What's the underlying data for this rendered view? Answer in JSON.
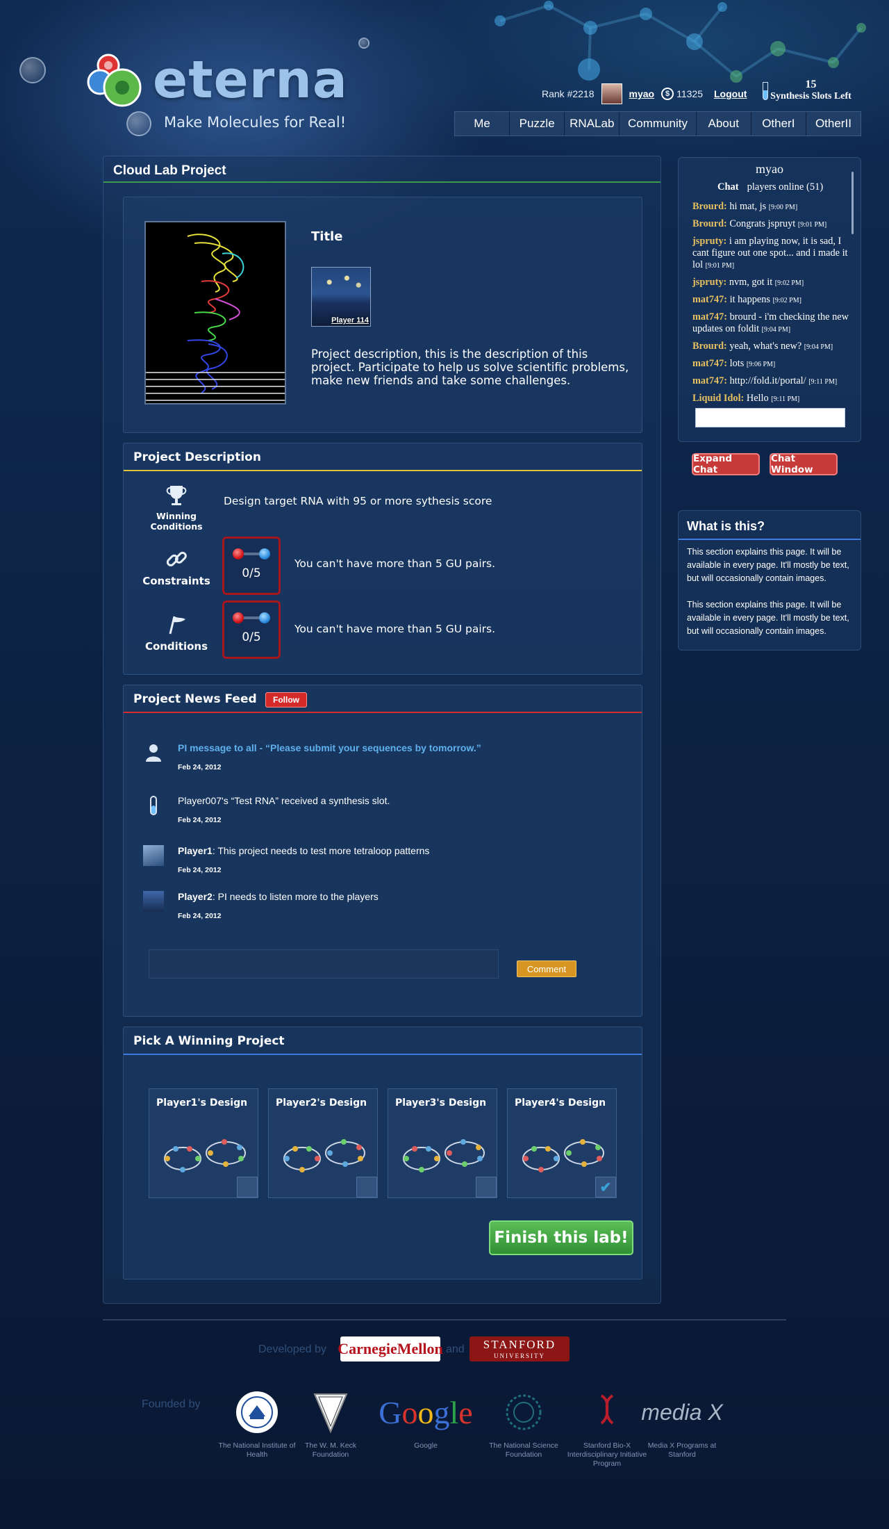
{
  "header": {
    "logo_text": "eterna",
    "tagline": "Make Molecules for Real!",
    "rank": "Rank #2218",
    "username": "myao",
    "coins": "11325",
    "logout": "Logout",
    "slots_count": "15",
    "slots_label": "Synthesis Slots Left",
    "coin_symbol": "$"
  },
  "nav": [
    "Me",
    "Puzzle",
    "RNALab",
    "Community",
    "About",
    "OtherI",
    "OtherII"
  ],
  "main": {
    "title": "Cloud Lab Project",
    "hero": {
      "title": "Title",
      "thumb_caption": "Player 114",
      "description": "Project description, this is the description of this project. Participate to help us solve scientific problems, make new friends and take some challenges."
    },
    "project_description": {
      "title": "Project Description",
      "line_color": "#e3c33a",
      "winning_label": "Winning Conditions",
      "winning_text": "Design target RNA with 95 or more sythesis score",
      "constraints_label": "Constraints",
      "constraints_count": "0/5",
      "constraints_text": "You can't have more than 5 GU pairs.",
      "conditions_label": "Conditions",
      "conditions_count": "0/5",
      "conditions_text": "You can't have more than 5 GU pairs."
    },
    "news_feed": {
      "title": "Project News Feed",
      "follow": "Follow",
      "line_color": "#d62b2b",
      "items": [
        {
          "icon": "person-icon",
          "author": "",
          "text": "PI message to all - “Please submit your sequences by tomorrow.”",
          "date": "Feb 24, 2012"
        },
        {
          "icon": "test-tube-icon",
          "author": "",
          "text": "Player007's “Test RNA” received a synthesis slot.",
          "date": "Feb 24, 2012"
        },
        {
          "icon": "player1-avatar-icon",
          "author": "Player1",
          "text": ":  This project needs to test more tetraloop patterns",
          "date": "Feb 24, 2012"
        },
        {
          "icon": "player2-avatar-icon",
          "author": "Player2",
          "text": ":  PI needs to listen more to the players",
          "date": "Feb 24, 2012"
        }
      ],
      "comment_button": "Comment"
    },
    "winning": {
      "title": "Pick A Winning Project",
      "line_color": "#3d7be0",
      "designs": [
        {
          "name": "Player1's Design",
          "selected": false
        },
        {
          "name": "Player2's Design",
          "selected": false
        },
        {
          "name": "Player3's Design",
          "selected": false
        },
        {
          "name": "Player4's Design",
          "selected": true
        }
      ],
      "finish_button": "Finish this lab!"
    }
  },
  "chat": {
    "username": "myao",
    "chat_label": "Chat",
    "online": "players online (51)",
    "messages": [
      {
        "who": "Brourd:",
        "text": " hi mat, js",
        "time": "[9:00 PM]"
      },
      {
        "who": "Brourd:",
        "text": " Congrats jspruyt",
        "time": "[9:01 PM]"
      },
      {
        "who": "jspruty:",
        "text": " i am playing now, it is sad, I cant figure out one spot... and i made it lol",
        "time": "[9:01 PM]"
      },
      {
        "who": "jspruty:",
        "text": " nvm, got it",
        "time": "[9:02 PM]"
      },
      {
        "who": "mat747:",
        "text": " it happens",
        "time": "[9:02 PM]"
      },
      {
        "who": "mat747:",
        "text": " brourd - i'm checking the new updates on foldit",
        "time": "[9:04 PM]"
      },
      {
        "who": "Brourd:",
        "text": " yeah, what's new?",
        "time": "[9:04 PM]"
      },
      {
        "who": "mat747:",
        "text": " lots",
        "time": "[9:06 PM]"
      },
      {
        "who": "mat747:",
        "text": " http://fold.it/portal/",
        "time": "[9:11 PM]"
      },
      {
        "who": "Liquid Idol:",
        "text": " Hello",
        "time": "[9:11 PM]"
      }
    ],
    "expand_chat": "Expand Chat",
    "chat_window": "Chat Window"
  },
  "info": {
    "title": "What is this?",
    "para1": "This section explains this page. It will be available in every page. It'll mostly be text, but will occasionally contain images.",
    "para2": "This section explains this page. It will be available in every page. It'll mostly be text, but will occasionally contain images."
  },
  "footer": {
    "developed_by": "Developed by",
    "and": "and",
    "cmu": "CarnegieMellon",
    "stanford_top": "STANFORD",
    "stanford_bottom": "UNIVERSITY",
    "founded_by": "Founded by",
    "sponsors": [
      {
        "name": "The National Institute of Health",
        "logo": "nih-logo"
      },
      {
        "name": "The W. M. Keck Foundation",
        "logo": "keck-logo"
      },
      {
        "name": "Google",
        "logo": "google-logo"
      },
      {
        "name": "The National Science Foundation",
        "logo": "nsf-logo"
      },
      {
        "name": "Stanford Bio-X Interdisciplinary Initiative Program",
        "logo": "biox-logo"
      },
      {
        "name": "Media X Programs at Stanford",
        "logo": "mediax-logo"
      }
    ],
    "google_text": "Google",
    "mediax_text": "media X"
  }
}
